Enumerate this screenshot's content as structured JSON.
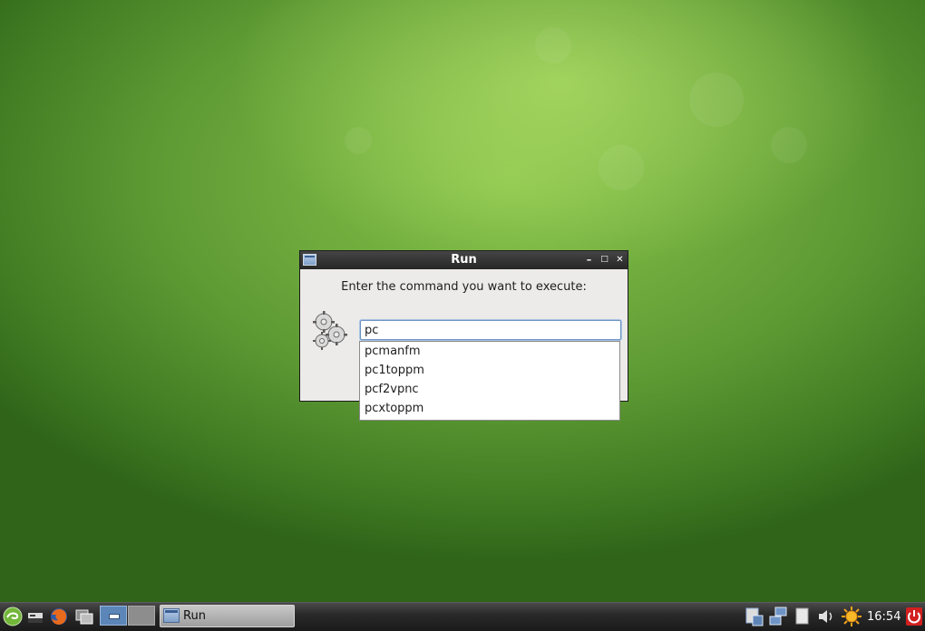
{
  "window": {
    "title": "Run",
    "minimize_glyph": "–",
    "maximize_glyph": "□",
    "close_glyph": "✕",
    "prompt": "Enter the command you want to execute:",
    "input_value": "pc"
  },
  "completions": [
    "pcmanfm",
    "pc1toppm",
    "pcf2vpnc",
    "pcxtoppm"
  ],
  "taskbar": {
    "launchers": [
      "distro-menu-icon",
      "terminal-icon",
      "firefox-icon",
      "windows-icon"
    ],
    "pager": [
      "desktop-1",
      "desktop-2"
    ],
    "tasks": [
      {
        "label": "Run",
        "icon": "window-icon"
      }
    ],
    "tray": [
      "clipboard-icon",
      "network-icon",
      "notes-icon",
      "volume-icon",
      "weather-sun-icon",
      "power-icon"
    ],
    "clock": "16:54"
  },
  "colors": {
    "desktop_green": "#6aa83b",
    "title_bar": "#2b2b2b",
    "input_focus": "#6d94c2",
    "power_red": "#d22020"
  }
}
